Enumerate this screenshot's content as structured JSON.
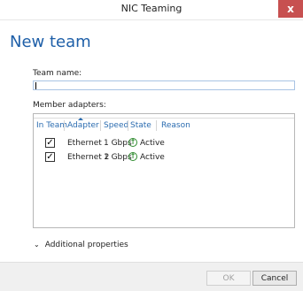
{
  "window": {
    "title": "NIC Teaming",
    "close_glyph": "x"
  },
  "page": {
    "heading": "New team"
  },
  "team_name": {
    "label": "Team name:",
    "value": ""
  },
  "member_adapters": {
    "label": "Member adapters:",
    "columns": [
      "In Team",
      "Adapter",
      "Speed",
      "State",
      "Reason"
    ],
    "rows": [
      {
        "in_team": true,
        "check": "✓",
        "adapter": "Ethernet",
        "speed": "1 Gbps",
        "state_icon": "↑",
        "state": "Active",
        "reason": ""
      },
      {
        "in_team": true,
        "check": "✓",
        "adapter": "Ethernet 2",
        "speed": "1 Gbps",
        "state_icon": "↑",
        "state": "Active",
        "reason": ""
      }
    ]
  },
  "additional": {
    "chevron": "⌄",
    "label": "Additional properties"
  },
  "buttons": {
    "ok": "OK",
    "cancel": "Cancel"
  }
}
